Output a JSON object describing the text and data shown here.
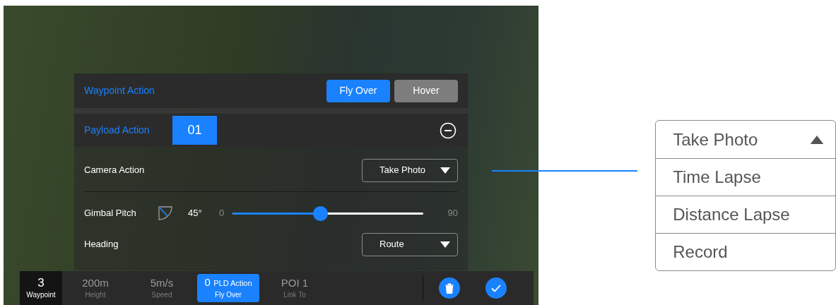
{
  "waypoint_action": {
    "label": "Waypoint Action",
    "options": [
      {
        "label": "Fly Over",
        "selected": true
      },
      {
        "label": "Hover",
        "selected": false
      }
    ]
  },
  "payload_action": {
    "label": "Payload Action",
    "index": "01"
  },
  "rows": [
    {
      "kind": "dropdown",
      "label": "Camera Action",
      "value": "Take Photo"
    },
    {
      "kind": "slider",
      "label": "Gimbal Pitch",
      "reading": "45°",
      "min": "0",
      "max": "90",
      "level": 0.46
    },
    {
      "kind": "dropdown",
      "label": "Heading",
      "value": "Route"
    }
  ],
  "bottom_bar": [
    {
      "kind": "waypoint",
      "value": "3",
      "caption": "Waypoint"
    },
    {
      "kind": "stat",
      "value": "200m",
      "caption": "Height"
    },
    {
      "kind": "stat",
      "value": "5m/s",
      "caption": "Speed"
    },
    {
      "kind": "action",
      "value": "0",
      "unit": "PLD Action",
      "caption": "Fly Over"
    },
    {
      "kind": "stat",
      "value": "POI 1",
      "caption": "Link To"
    }
  ],
  "dropdown_list": {
    "options": [
      "Take Photo",
      "Time Lapse",
      "Distance Lapse",
      "Record"
    ]
  }
}
